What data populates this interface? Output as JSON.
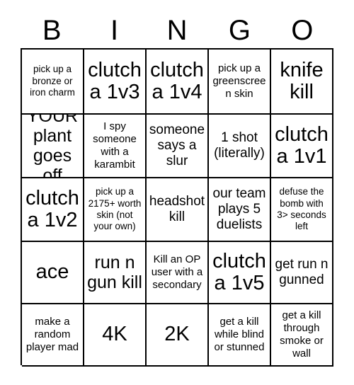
{
  "header": {
    "letters": [
      "B",
      "I",
      "N",
      "G",
      "O"
    ]
  },
  "grid": {
    "columns": 5,
    "rows": 5,
    "cells": [
      {
        "text": "pick up a bronze or iron charm",
        "size": "xs"
      },
      {
        "text": "clutch a 1v3",
        "size": "xl"
      },
      {
        "text": "clutch a 1v4",
        "size": "xl"
      },
      {
        "text": "pick up a greenscreen skin",
        "size": "sm"
      },
      {
        "text": "knife kill",
        "size": "xl"
      },
      {
        "text": "YOUR plant goes off",
        "size": "lg"
      },
      {
        "text": "I spy someone with a karambit",
        "size": "sm"
      },
      {
        "text": "someone says a slur",
        "size": "md"
      },
      {
        "text": "1 shot (literally)",
        "size": "md"
      },
      {
        "text": "clutch a 1v1",
        "size": "xl"
      },
      {
        "text": "clutch a 1v2",
        "size": "xl"
      },
      {
        "text": "pick up a 2175+ worth skin (not your own)",
        "size": "xs"
      },
      {
        "text": "headshot kill",
        "size": "md"
      },
      {
        "text": "our team plays 5 duelists",
        "size": "md"
      },
      {
        "text": "defuse the bomb with 3> seconds left",
        "size": "xs"
      },
      {
        "text": "ace",
        "size": "xl"
      },
      {
        "text": "run n gun kill",
        "size": "lg"
      },
      {
        "text": "Kill an OP user with a secondary",
        "size": "sm"
      },
      {
        "text": "clutch a 1v5",
        "size": "xl"
      },
      {
        "text": "get run n gunned",
        "size": "md"
      },
      {
        "text": "make a random player mad",
        "size": "sm"
      },
      {
        "text": "4K",
        "size": "xl"
      },
      {
        "text": "2K",
        "size": "xl"
      },
      {
        "text": "get a kill while blind or stunned",
        "size": "sm"
      },
      {
        "text": "get a kill through smoke or wall",
        "size": "sm"
      }
    ]
  },
  "colors": {
    "background": "#ffffff",
    "text": "#000000",
    "grid_line": "#000000"
  }
}
